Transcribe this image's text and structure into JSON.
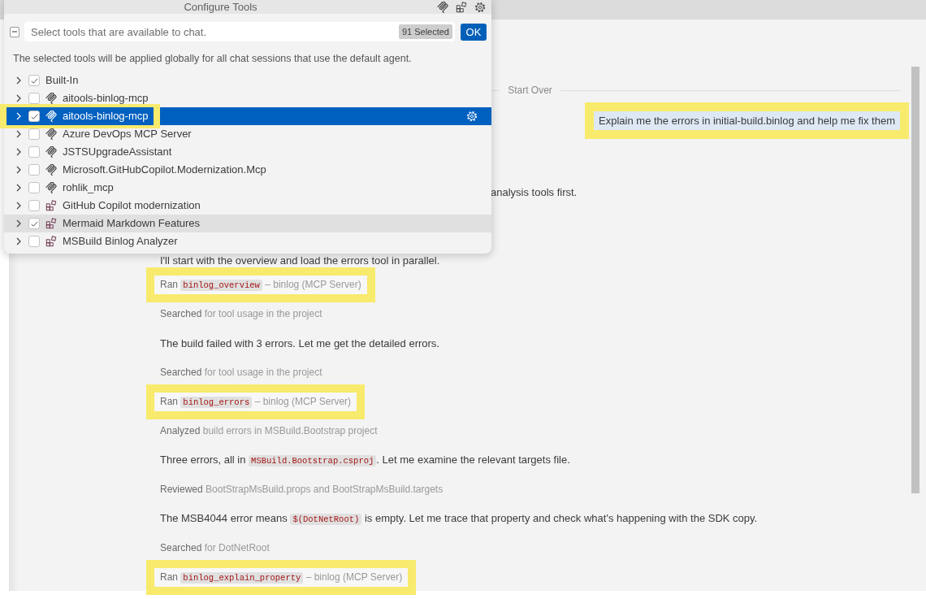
{
  "tools_dialog": {
    "title": "Configure Tools",
    "select_all": {
      "indeterminate": true
    },
    "search": {
      "placeholder": "Select tools that are available to chat.",
      "badge": "91 Selected"
    },
    "ok_button": "OK",
    "description": "The selected tools will be applied globally for all chat sessions that use the default agent.",
    "tools": [
      {
        "label": "Built-In",
        "kind": "builtin",
        "checked": true,
        "selected": false,
        "hovered": false,
        "highlighted": false
      },
      {
        "label": "aitools-binlog-mcp",
        "kind": "mcp_server",
        "checked": false,
        "selected": false,
        "hovered": false,
        "highlighted": false
      },
      {
        "label": "aitools-binlog-mcp",
        "kind": "mcp_server",
        "checked": true,
        "selected": true,
        "hovered": false,
        "highlighted": true
      },
      {
        "label": "Azure DevOps MCP Server",
        "kind": "mcp_server",
        "checked": false,
        "selected": false,
        "hovered": false,
        "highlighted": false
      },
      {
        "label": "JSTSUpgradeAssistant",
        "kind": "mcp_server",
        "checked": false,
        "selected": false,
        "hovered": false,
        "highlighted": false
      },
      {
        "label": "Microsoft.GitHubCopilot.Modernization.Mcp",
        "kind": "mcp_server",
        "checked": false,
        "selected": false,
        "hovered": false,
        "highlighted": false
      },
      {
        "label": "rohlik_mcp",
        "kind": "mcp_server",
        "checked": false,
        "selected": false,
        "hovered": false,
        "highlighted": false
      },
      {
        "label": "GitHub Copilot modernization",
        "kind": "extension",
        "checked": false,
        "selected": false,
        "hovered": false,
        "highlighted": false
      },
      {
        "label": "Mermaid Markdown Features",
        "kind": "extension",
        "checked": true,
        "selected": false,
        "hovered": true,
        "highlighted": false
      },
      {
        "label": "MSBuild Binlog Analyzer",
        "kind": "extension",
        "checked": false,
        "selected": false,
        "hovered": false,
        "highlighted": false
      }
    ]
  },
  "chat": {
    "divider": "Start Over",
    "user_message": {
      "text": "Explain me the errors in initial-build.binlog and help me fix them",
      "highlighted": true
    },
    "messages": [
      {
        "kind": "clipped_text",
        "parts": [
          {
            "kind": "plain",
            "text": "analysis tools first."
          }
        ],
        "highlighted": false
      },
      {
        "kind": "text",
        "parts": [
          {
            "kind": "plain",
            "text": "I'll start with the overview and load the errors tool in parallel."
          }
        ],
        "highlighted": false
      },
      {
        "kind": "tool_call",
        "verb": "Ran",
        "tool": "binlog_overview",
        "detail": "– binlog (MCP Server)",
        "highlighted": true
      },
      {
        "kind": "activity",
        "verb": "Searched",
        "detail": "for tool usage in the project",
        "highlighted": false
      },
      {
        "kind": "text",
        "parts": [
          {
            "kind": "plain",
            "text": "The build failed with 3 errors. Let me get the detailed errors."
          }
        ],
        "highlighted": false
      },
      {
        "kind": "activity",
        "verb": "Searched",
        "detail": "for tool usage in the project",
        "highlighted": false
      },
      {
        "kind": "tool_call",
        "verb": "Ran",
        "tool": "binlog_errors",
        "detail": "– binlog (MCP Server)",
        "highlighted": true
      },
      {
        "kind": "activity",
        "verb": "Analyzed",
        "detail": "build errors in MSBuild.Bootstrap project",
        "highlighted": false
      },
      {
        "kind": "text",
        "parts": [
          {
            "kind": "plain",
            "text": "Three errors, all in "
          },
          {
            "kind": "code",
            "text": "MSBuild.Bootstrap.csproj"
          },
          {
            "kind": "plain",
            "text": ". Let me examine the relevant targets file."
          }
        ],
        "highlighted": false
      },
      {
        "kind": "activity",
        "verb": "Reviewed",
        "detail": "BootStrapMsBuild.props and BootStrapMsBuild.targets",
        "highlighted": false
      },
      {
        "kind": "text",
        "parts": [
          {
            "kind": "plain",
            "text": "The MSB4044 error means "
          },
          {
            "kind": "code",
            "text": "$(DotNetRoot)"
          },
          {
            "kind": "plain",
            "text": " is empty. Let me trace that property and check what's happening with the SDK copy."
          }
        ],
        "highlighted": false
      },
      {
        "kind": "activity",
        "verb": "Searched",
        "detail": "for DotNetRoot",
        "highlighted": false
      },
      {
        "kind": "tool_call",
        "verb": "Ran",
        "tool": "binlog_explain_property",
        "detail": "– binlog (MCP Server)",
        "highlighted": true
      }
    ]
  }
}
